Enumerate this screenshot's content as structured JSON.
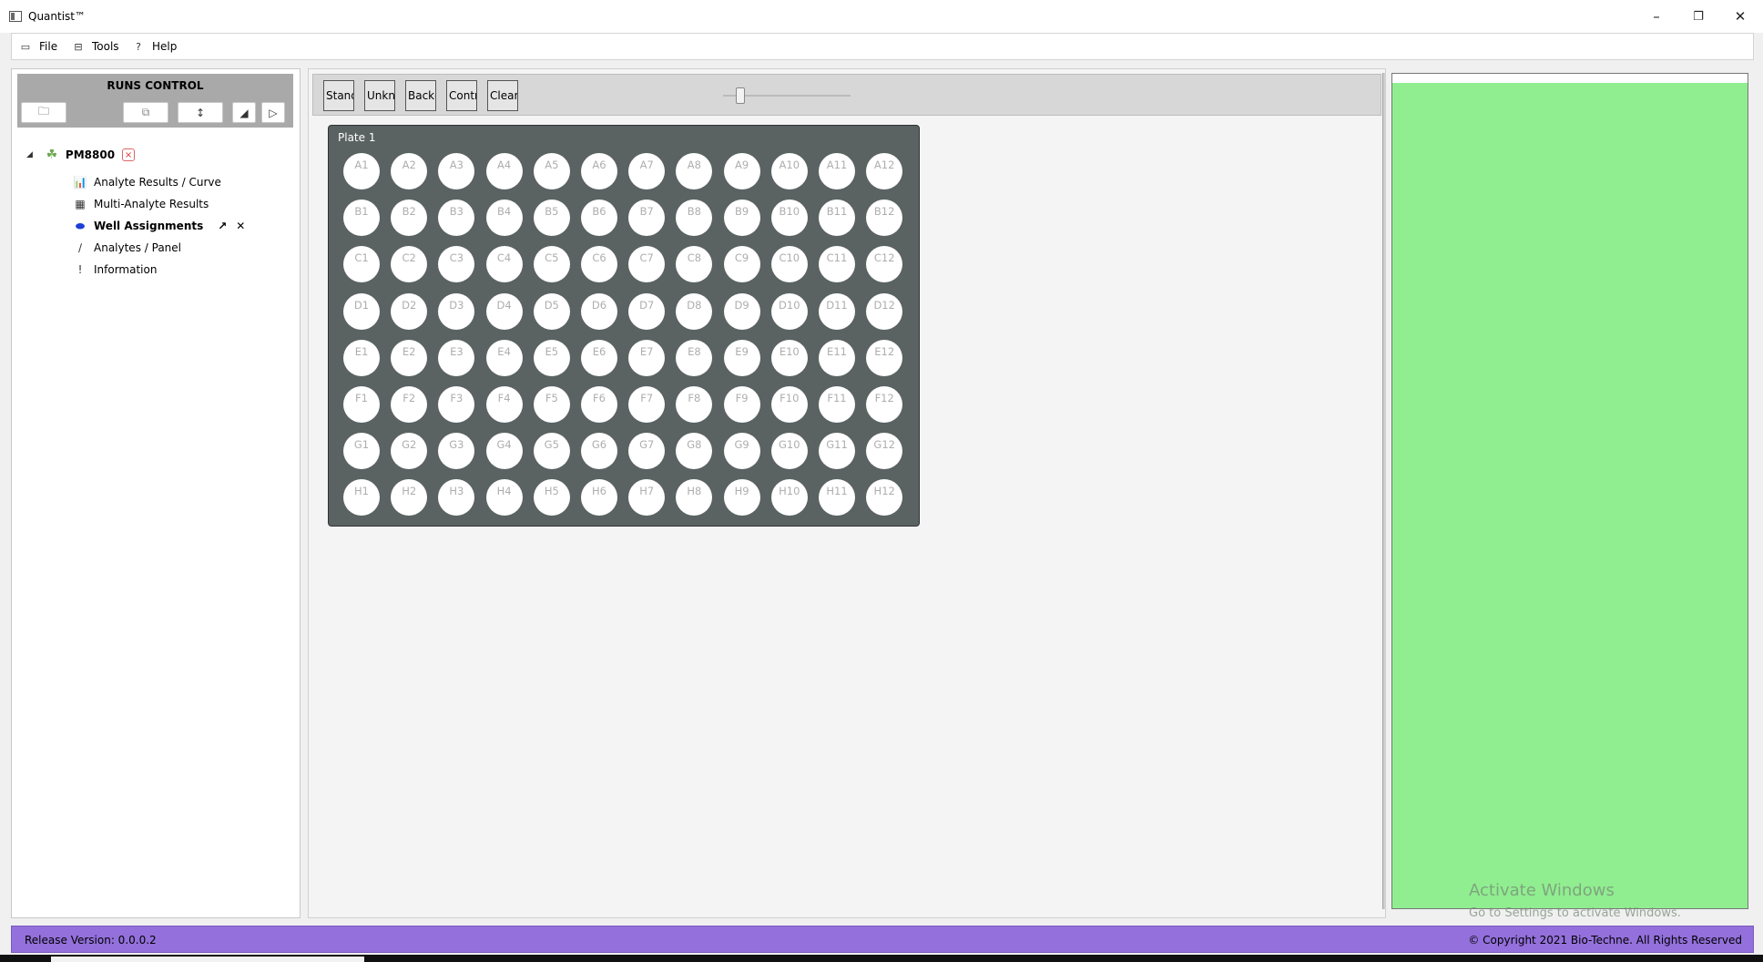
{
  "window": {
    "title": "Quantist™",
    "minimize_icon": "minimize-icon",
    "restore_icon": "restore-icon",
    "close_icon": "close-icon"
  },
  "menu": [
    {
      "label": "File",
      "icon": "file-icon"
    },
    {
      "label": "Tools",
      "icon": "tools-icon"
    },
    {
      "label": "Help",
      "icon": "help-icon"
    }
  ],
  "runs_control": {
    "title": "RUNS CONTROL",
    "toolbar_icons": [
      "folder-open-icon",
      "copy-icon",
      "sort-icon",
      "collapse-icon",
      "play-icon"
    ]
  },
  "tree": {
    "run": {
      "label": "PM8800",
      "expanded": true,
      "close_badge": "×"
    },
    "items": [
      {
        "label": "Analyte Results / Curve",
        "icon": "chart-icon",
        "active": false
      },
      {
        "label": "Multi-Analyte Results",
        "icon": "calculator-icon",
        "active": false
      },
      {
        "label": "Well Assignments",
        "icon": "plate-icon",
        "active": true,
        "pin": "↗",
        "close": "✕"
      },
      {
        "label": "Analytes / Panel",
        "icon": "pipette-icon",
        "active": false
      },
      {
        "label": "Information",
        "icon": "info-icon",
        "active": false
      }
    ]
  },
  "assign_toolbar": {
    "buttons": [
      "Stand",
      "Unkno",
      "Backg",
      "Contr",
      "Clear"
    ],
    "zoom_slider": 0.1
  },
  "plate": {
    "title": "Plate  1",
    "rows": [
      "A",
      "B",
      "C",
      "D",
      "E",
      "F",
      "G",
      "H"
    ],
    "columns": 12
  },
  "watermark": {
    "title": "Activate Windows",
    "subtitle": "Go to Settings to activate Windows."
  },
  "status": {
    "release": "Release Version: 0.0.0.2",
    "copyright": "© Copyright 2021 Bio-Techne. All Rights Reserved"
  },
  "colors": {
    "status_bar": "#9370db",
    "right_panel": "#90ee90",
    "plate_bg": "#5a6262"
  }
}
